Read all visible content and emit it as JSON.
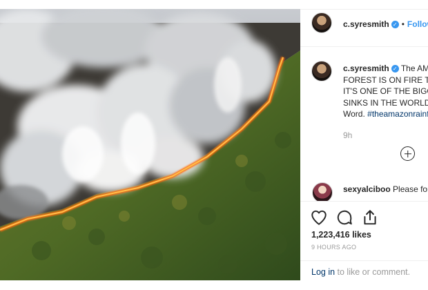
{
  "post": {
    "username": "c.syresmith",
    "verified_glyph": "✓",
    "separator": "•",
    "follow_label": "Follow",
    "caption_user": "c.syresmith",
    "caption_lines": [
      "The AMAZON",
      "FOREST IS ON FIRE THE LUNGS",
      "IT'S ONE OF THE BIGGEST CARBON",
      "SINKS IN THE WORLD. Spread the",
      "Word."
    ],
    "hashtag": "#theamazonrainforest",
    "time_small": "9h",
    "comment2_user": "sexyalciboo",
    "comment2_text": "Please forward",
    "likes": "1,223,416 likes",
    "time_ago": "9 HOURS AGO",
    "login_link": "Log in",
    "login_text": " to like or comment.",
    "icons": [
      "heart-icon",
      "comment-icon",
      "share-icon",
      "add-comment-icon"
    ],
    "colors": {
      "link_blue": "#3897f0",
      "hashtag_blue": "#003569",
      "muted": "#999999",
      "text": "#262626",
      "fire": "#ff7a1a"
    }
  }
}
